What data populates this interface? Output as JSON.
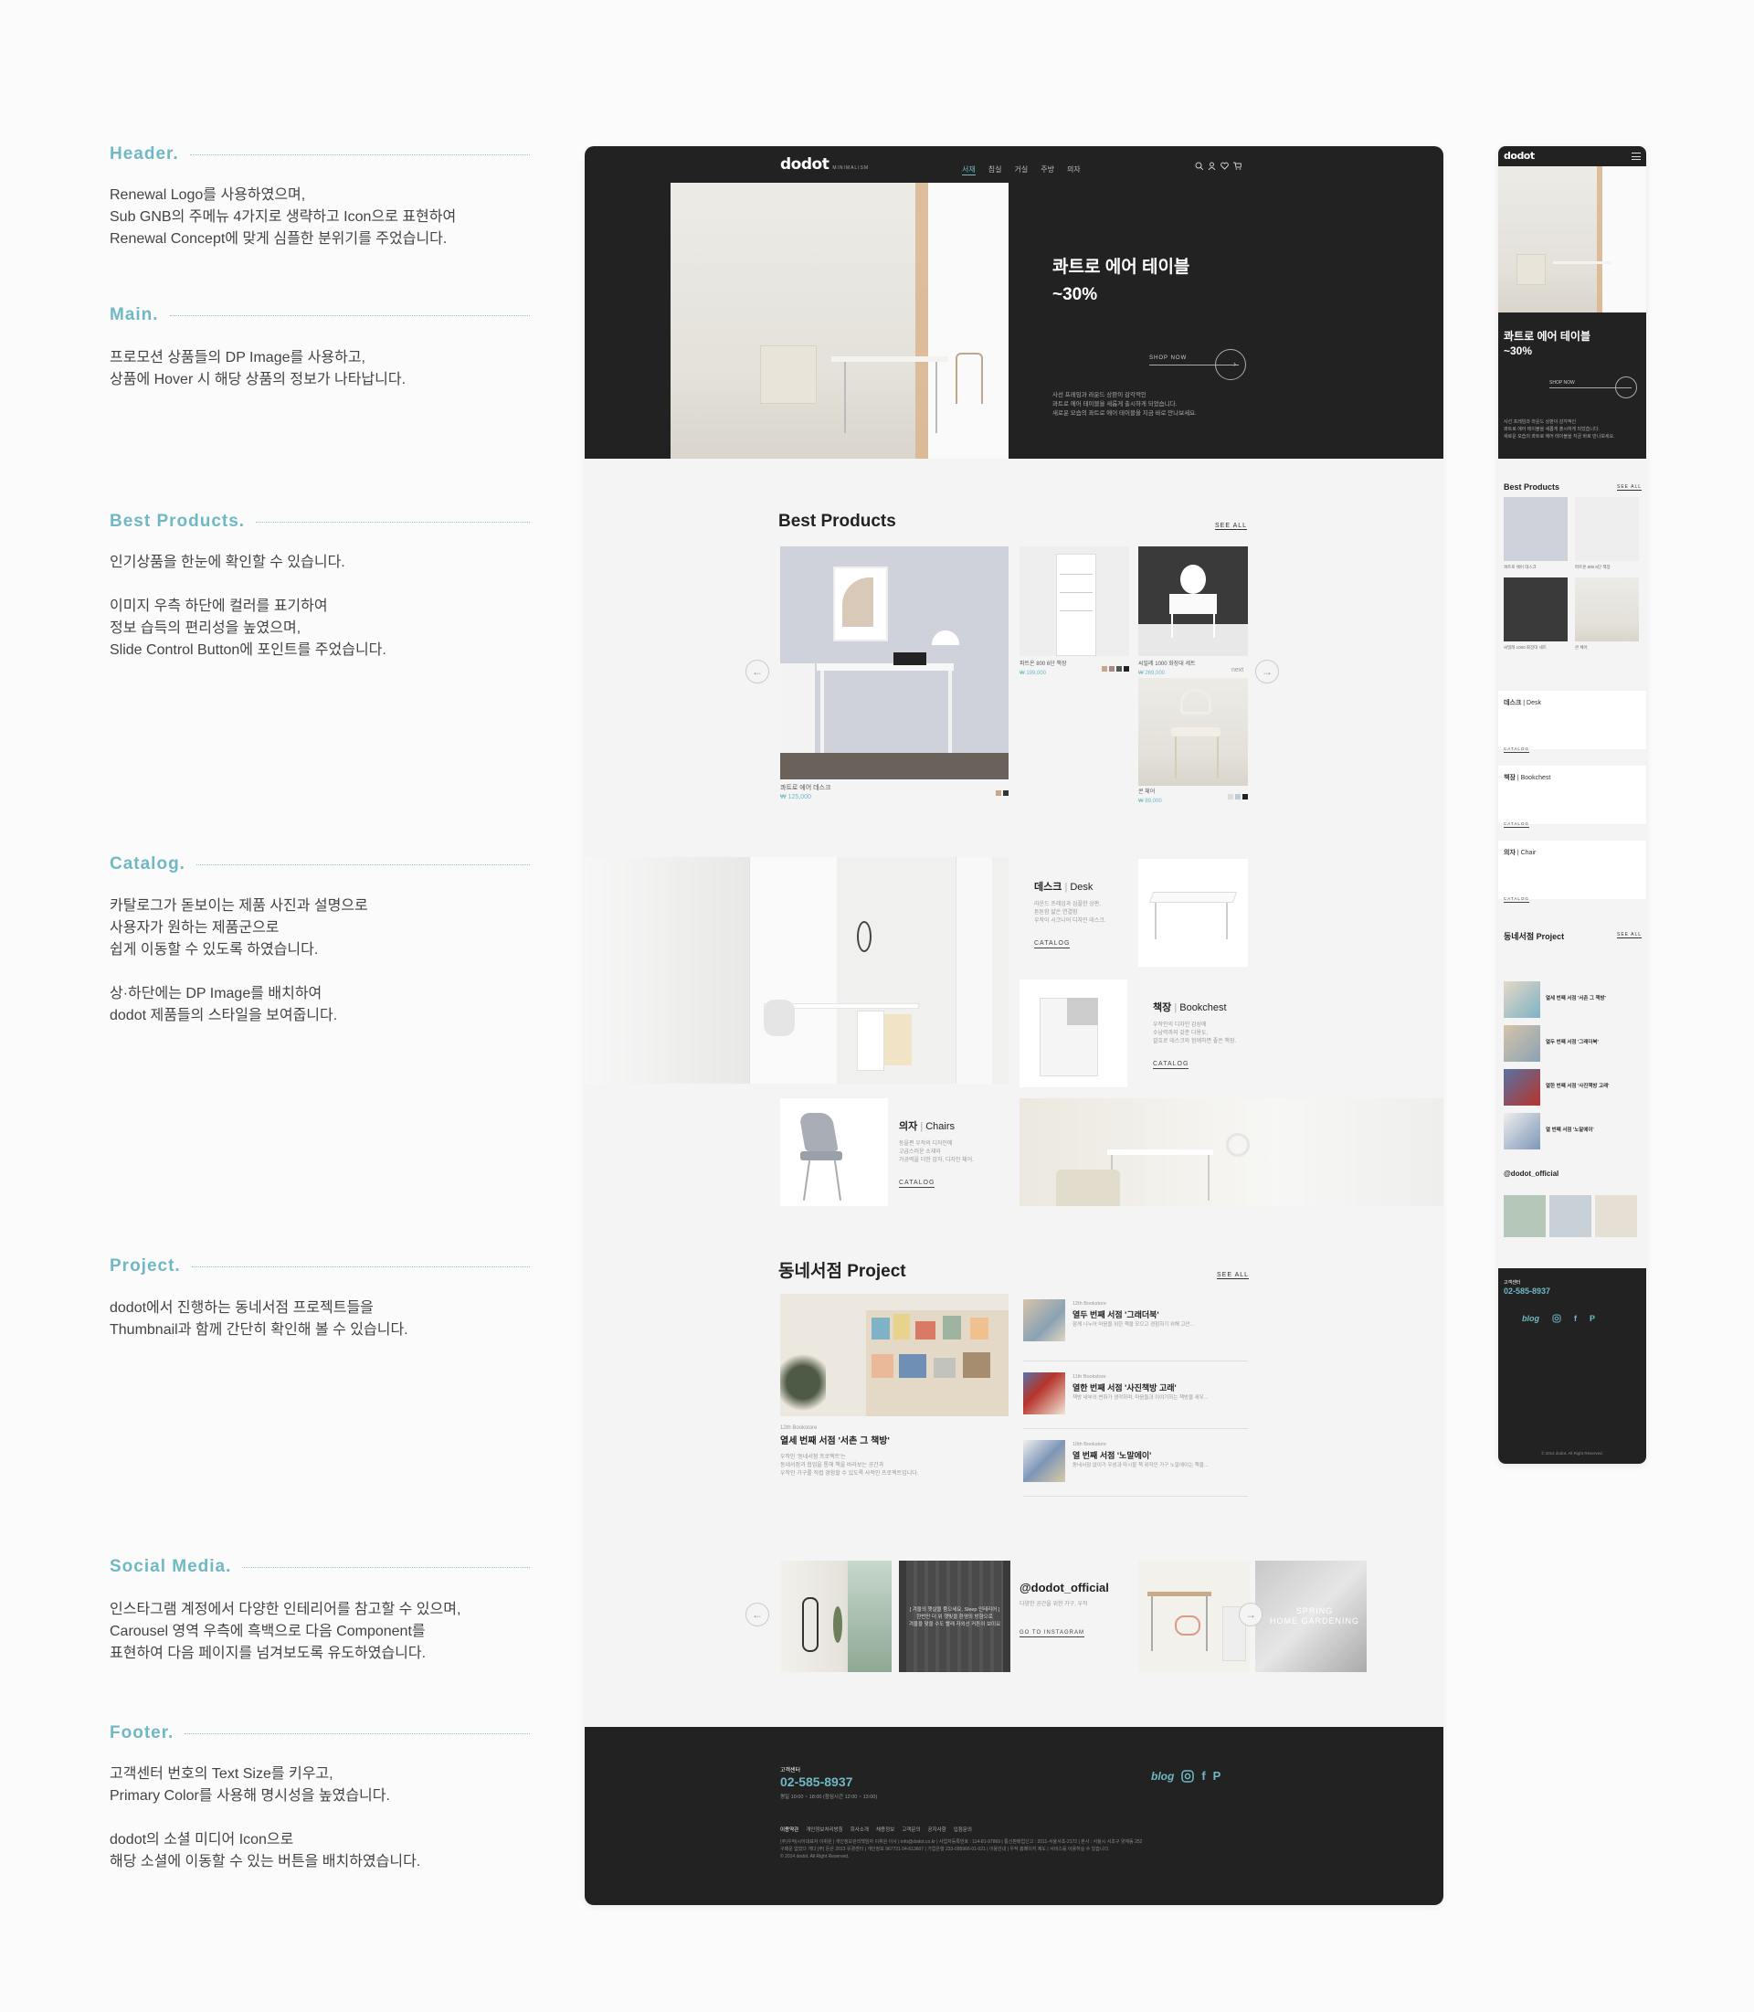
{
  "annotations": [
    {
      "title": "Header.",
      "lines": [
        "Renewal Logo를 사용하였으며,",
        "Sub GNB의 주메뉴 4가지로 생략하고 Icon으로 표현하여",
        "Renewal Concept에 맞게 심플한 분위기를 주었습니다."
      ]
    },
    {
      "title": "Main.",
      "lines": [
        "프로모션 상품들의 DP Image를 사용하고,",
        "상품에 Hover 시 해당 상품의 정보가 나타납니다."
      ]
    },
    {
      "title": "Best Products.",
      "lines": [
        "인기상품을 한눈에 확인할 수 있습니다."
      ],
      "lines2": [
        "이미지 우측 하단에 컬러를 표기하여",
        "정보 습득의 편리성을 높였으며,",
        "Slide Control Button에 포인트를 주었습니다."
      ]
    },
    {
      "title": "Catalog.",
      "lines": [
        "카탈로그가 돋보이는 제품 사진과 설명으로",
        "사용자가 원하는 제품군으로",
        "쉽게 이동할 수 있도록 하였습니다."
      ],
      "lines2": [
        "상·하단에는 DP Image를 배치하여",
        "dodot 제품들의 스타일을 보여줍니다."
      ]
    },
    {
      "title": "Project.",
      "lines": [
        "dodot에서 진행하는 동네서점 프로젝트들을",
        "Thumbnail과 함께 간단히 확인해 볼 수 있습니다."
      ]
    },
    {
      "title": "Social Media.",
      "lines": [
        "인스타그램 계정에서 다양한 인테리어를 참고할 수 있으며,",
        "Carousel 영역 우측에 흑백으로 다음 Component를",
        "표현하여 다음 페이지를 넘겨보도록 유도하였습니다."
      ]
    },
    {
      "title": "Footer.",
      "lines": [
        "고객센터 번호의 Text Size를 키우고,",
        "Primary Color를 사용해 명시성을 높였습니다."
      ],
      "lines2": [
        "dodot의 소셜 미디어 Icon으로",
        "해당 소셜에 이동할 수 있는 버튼을 배치하였습니다."
      ]
    }
  ],
  "header": {
    "logo_main": "do",
    "logo_accent": "dot",
    "logo_sub": "MINIMALISM",
    "nav": [
      "서재",
      "침실",
      "거실",
      "주방",
      "의자"
    ]
  },
  "hero": {
    "title1": "콰트로 에어 테이블",
    "title2": "~30%",
    "shop_now": "SHOP NOW",
    "desc": [
      "사선 프레임과 라운드 상판이 감각적인",
      "콰트로 에어 테이블을 새롭게 출시하게 되었습니다.",
      "새로운 모습의 콰트로 에어 테이블을 지금 바로 만나보세요."
    ]
  },
  "best": {
    "title": "Best Products",
    "see_all": "SEE ALL",
    "prev": "prev",
    "next": "next",
    "items": [
      {
        "name": "콰트로 에어 데스크",
        "price": "₩ 125,000"
      },
      {
        "name": "파트온 800 6단 책장",
        "price": "₩ 199,000"
      },
      {
        "name": "씨밀레 1000 화장대 세트",
        "price": "₩ 269,000"
      },
      {
        "name": "콘 체어",
        "price": "₩ 89,000"
      }
    ]
  },
  "catalog": {
    "items": [
      {
        "ko": "데스크",
        "en": "Desk",
        "desc": [
          "라운드 프레임과 심플한 상판,",
          "튼튼함 얇은 연결함",
          "우작이 시크니어 디자인 데스크."
        ],
        "link": "CATALOG"
      },
      {
        "ko": "책장",
        "en": "Bookchest",
        "desc": [
          "우작인의 디자인 감성에",
          "수납력까지 갖춘 다용도,",
          "괄호로 데스크와 함께하면 좋은 책장."
        ],
        "link": "CATALOG"
      },
      {
        "ko": "의자",
        "en": "Chairs",
        "desc": [
          "등을편 우작의 디자인에",
          "고급스러운 소재와",
          "가공력을 더한 감처, 디자인 체어."
        ],
        "link": "CATALOG"
      }
    ]
  },
  "project": {
    "title": "동네서점 Project",
    "see_all": "SEE ALL",
    "main": {
      "tag": "12th Bookstore",
      "title": "열세 번째 서점 '서촌 그 책방'",
      "desc": [
        "우작인 '동네서점 프로젝트'는",
        "동네서점과 협업을 통해 책을 바라보는 공간과",
        "우작인 가구를 직접 경험할 수 있도록 사적인 프로젝트입니다."
      ]
    },
    "list": [
      {
        "tag": "12th Bookstore",
        "title": "열두 번째 서점 '그래더북'",
        "desc": "함께 나누어 마음을 위한 책을 모으고 경험하기 위해 고안..."
      },
      {
        "tag": "11th Bookstore",
        "title": "열한 번째 서점 '사진책방 고래'",
        "desc": "책방 내부의 변화가 생각하며, 마음들과 이야기하는 책방을 새우..."
      },
      {
        "tag": "10th Bookstore",
        "title": "열 번째 서점 '노말에이'",
        "desc": "동네서점 없이가 우성과 마시할 책 위작인 가구 노말에이는 책을..."
      }
    ]
  },
  "social": {
    "handle": "@dodot_official",
    "desc": "다양한 공간을 위한 가구, 우작",
    "link": "GO TO INSTAGRAM",
    "prev": "prev",
    "caption": [
      "[ 겨울의 햇살을 품으세요, Sleep 인테리어 ]",
      "한번만 더 위 햇빛을 환영의 방향으로",
      "겨울을 맞을 수도 빨래 자외선 커튼이 보이요"
    ],
    "spring": [
      "SPRING",
      "HOME GARDENING"
    ]
  },
  "footer": {
    "cs_label": "고객센터",
    "phone": "02-585-8937",
    "hours": "평일 10:00 ~ 18:00 (점심시간 12:00 ~ 13:00)",
    "blog": "blog",
    "links": [
      "이용약관",
      "개인정보처리방침",
      "회사소개",
      "채용정보",
      "고객문의",
      "공지사항",
      "입점문의"
    ],
    "info": [
      "(주)우작|시어대표자 이휘원 | 개인정보관리책임자 이휘원 이사 | info@dodot.co.kr | 사업자등록번호 : 114-81-97869 | 통신판매업신고 : 2011-서울서초-2172 | 본사 : 서울시 서초구 양재동 252",
      "구매운 없었다 게다 [주] 돈은 2013 유경센터 | 개인정보 967721 04-613607 | 기업은행 233-095966-01-021 | 이용안내 | 우작 홈페이지 제도 | 서비스를 이용하실 수 있습니다.",
      "© 2014 dodot. All Right Reserved."
    ]
  },
  "mobile": {
    "hero_title1": "콰트로 에어 테이블",
    "hero_title2": "~30%",
    "shop_now": "SHOP NOW",
    "best_title": "Best Products",
    "see_all": "SEE ALL",
    "catalog": [
      {
        "ko": "데스크",
        "en": "Desk",
        "link": "CATALOG"
      },
      {
        "ko": "책장",
        "en": "Bookchest",
        "link": "CATALOG"
      },
      {
        "ko": "의자",
        "en": "Chair",
        "link": "CATALOG"
      }
    ],
    "project_title": "동네서점 Project",
    "projects": [
      "열세 번째 서점 '서촌 그 책방'",
      "열두 번째 서점 '그래더북'",
      "열한 번째 서점 '사진책방 고래'",
      "열 번째 서점 '노말에이'"
    ],
    "social_handle": "@dodot_official",
    "cs_label": "고객센터",
    "phone": "02-585-8937",
    "blog": "blog",
    "copyright": "© 2014 dodot. All Right Reserved."
  },
  "colors": {
    "primary": "#6fb8c4",
    "dark": "#222222",
    "bg": "#f4f4f4"
  }
}
